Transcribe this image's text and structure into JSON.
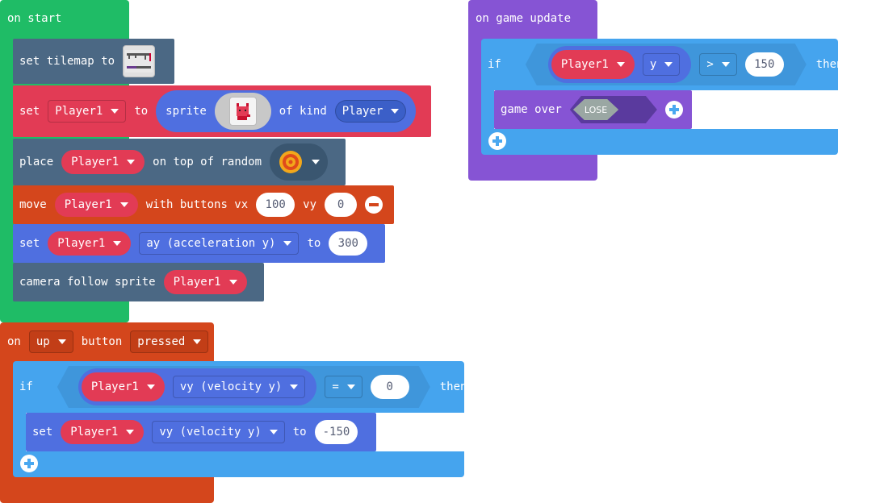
{
  "colors": {
    "event_green": "#1fbc66",
    "sprites_blue": "#4b6884",
    "variable_red": "#e23b55",
    "sprite_kind_blue": "#3b6ed8",
    "controller_orange": "#d4461c",
    "physics_blue": "#4f6fe0",
    "logic_blue": "#45a4ee",
    "game_purple": "#8654d4"
  },
  "on_start": {
    "header": "on start",
    "set_tilemap": {
      "set": "set tilemap to",
      "thumb": "tilemap-thumbnail"
    },
    "set_sprite": {
      "set": "set",
      "var": "Player1",
      "to": "to",
      "sprite": "sprite",
      "of_kind": "of kind",
      "kind": "Player"
    },
    "place": {
      "place": "place",
      "var": "Player1",
      "on_top": "on top of random"
    },
    "move": {
      "move": "move",
      "var": "Player1",
      "with_buttons": "with buttons vx",
      "vx": "100",
      "vy_label": "vy",
      "vy": "0"
    },
    "set_ay": {
      "set": "set",
      "var": "Player1",
      "prop": "ay (acceleration y)",
      "to": "to",
      "value": "300"
    },
    "camera": {
      "label": "camera follow sprite",
      "var": "Player1"
    }
  },
  "on_button": {
    "on": "on",
    "button": "up",
    "button_label": "button",
    "event": "pressed",
    "if": "if",
    "cond_var": "Player1",
    "cond_prop": "vy (velocity y)",
    "op": "=",
    "cond_value": "0",
    "then": "then",
    "set": "set",
    "set_var": "Player1",
    "set_prop": "vy (velocity y)",
    "set_to": "to",
    "set_value": "-150"
  },
  "on_update": {
    "header": "on game update",
    "if": "if",
    "cond_var": "Player1",
    "cond_prop": "y",
    "op": ">",
    "cond_value": "150",
    "then": "then",
    "game_over": "game over",
    "lose": "LOSE"
  }
}
